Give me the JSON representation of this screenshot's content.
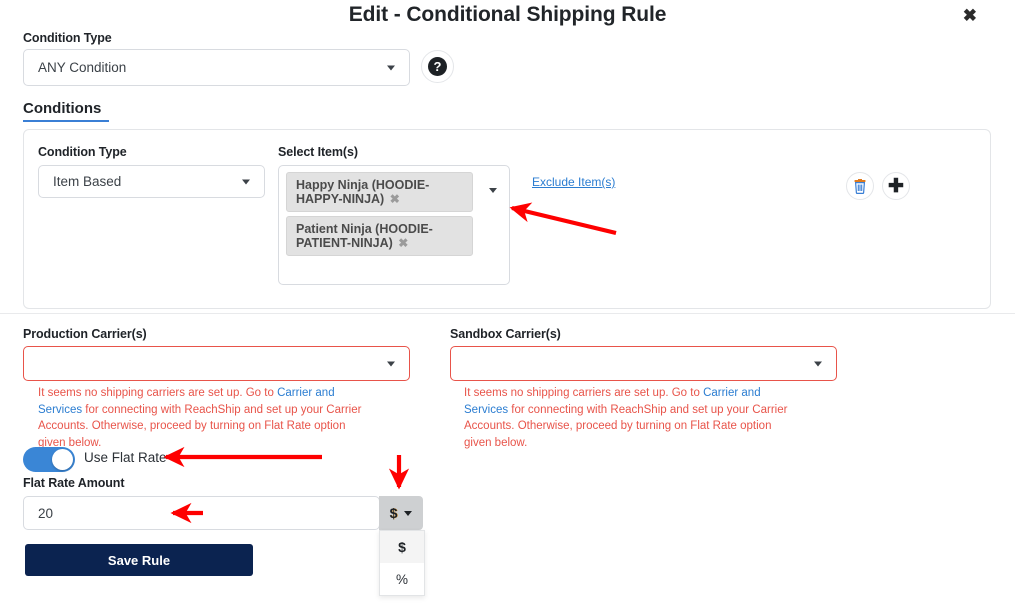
{
  "modal": {
    "title": "Edit - Conditional Shipping Rule",
    "close_icon": "close-icon",
    "close_glyph": "✖"
  },
  "top": {
    "condition_type_label": "Condition Type",
    "condition_type_value": "ANY Condition",
    "help_icon": "question-mark-icon",
    "help_glyph": "?"
  },
  "conditions": {
    "heading": "Conditions",
    "row": {
      "condition_type_label": "Condition Type",
      "condition_type_value": "Item Based",
      "select_items_label": "Select Item(s)",
      "selected_items": [
        {
          "name": "Happy Ninja (HOODIE-HAPPY-NINJA)",
          "remove_glyph": "✖"
        },
        {
          "name": "Patient Ninja (HOODIE-PATIENT-NINJA)",
          "remove_glyph": "✖"
        }
      ],
      "exclude_link": "Exclude Item(s)",
      "delete_icon": "trash-icon",
      "add_icon": "plus-icon",
      "add_glyph": "✚"
    }
  },
  "carriers": {
    "production": {
      "label": "Production Carrier(s)",
      "value": "",
      "note_part1": "It seems no shipping carriers are set up. Go to ",
      "note_link": "Carrier and Services",
      "note_part2": " for connecting with ReachShip and set up your Carrier Accounts. Otherwise, proceed by turning on Flat Rate option given below."
    },
    "sandbox": {
      "label": "Sandbox Carrier(s)",
      "value": "",
      "note_part1": "It seems no shipping carriers are set up. Go to ",
      "note_link": "Carrier and Services",
      "note_part2": " for connecting with ReachShip and set up your Carrier Accounts. Otherwise, proceed by turning on Flat Rate option given below."
    }
  },
  "flat_rate": {
    "toggle_label": "Use Flat Rate",
    "toggle_on": "on",
    "amount_label": "Flat Rate Amount",
    "amount_value": "20",
    "amount_placeholder": "",
    "currency_selected": "$",
    "currency_options": [
      "$",
      "%"
    ]
  },
  "actions": {
    "save_label": "Save Rule"
  },
  "colors": {
    "accent_blue": "#3a7fd5",
    "link_blue": "#2b7dd1",
    "error_red": "#e8544a",
    "save_navy": "#0b2350",
    "toggle_on": "#3a86d6",
    "annotation_red": "#fe0000"
  }
}
